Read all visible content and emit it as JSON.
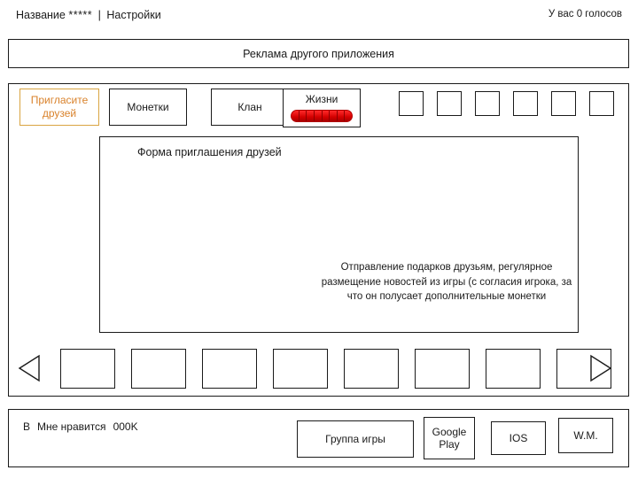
{
  "topbar": {
    "title_label": "Название",
    "stars": "*****",
    "separator": "|",
    "settings_label": "Настройки",
    "votes_label": "У вас 0 голосов"
  },
  "ad_banner": {
    "text": "Реклама другого приложения"
  },
  "tabs": [
    {
      "id": "invite",
      "label": "Пригласите друзей",
      "active": true,
      "accent": "#d9822b"
    },
    {
      "id": "coins",
      "label": "Монетки",
      "active": false
    },
    {
      "id": "clan",
      "label": "Клан",
      "active": false
    },
    {
      "id": "lives",
      "label": "Жизни",
      "active": false,
      "bar_color": "#e00000",
      "bar_segments": 8
    }
  ],
  "tab_slots": [
    {
      "id": "slot-1"
    },
    {
      "id": "slot-2"
    },
    {
      "id": "slot-3"
    },
    {
      "id": "slot-4"
    },
    {
      "id": "slot-5"
    },
    {
      "id": "slot-6"
    }
  ],
  "main_panel": {
    "title": "Форма приглашения друзей",
    "paragraph": "Отправление подарков друзьям, регулярное размещение новостей из игры (с согласия игрока, за что он полусает дополнительные монетки"
  },
  "carousel": {
    "prev_icon": "triangle-left-icon",
    "next_icon": "triangle-right-icon",
    "items": [
      {
        "id": "item-1"
      },
      {
        "id": "item-2"
      },
      {
        "id": "item-3"
      },
      {
        "id": "item-4"
      },
      {
        "id": "item-5"
      },
      {
        "id": "item-6"
      },
      {
        "id": "item-7"
      },
      {
        "id": "item-8"
      }
    ]
  },
  "bottombar": {
    "vk_icon_glyph": "В",
    "like_label": "Мне нравится",
    "like_count": "000K",
    "buttons": [
      {
        "id": "group",
        "label": "Группа игры"
      },
      {
        "id": "gplay",
        "label": "Google Play"
      },
      {
        "id": "ios",
        "label": "IOS"
      },
      {
        "id": "wm",
        "label": "W.M."
      }
    ]
  }
}
